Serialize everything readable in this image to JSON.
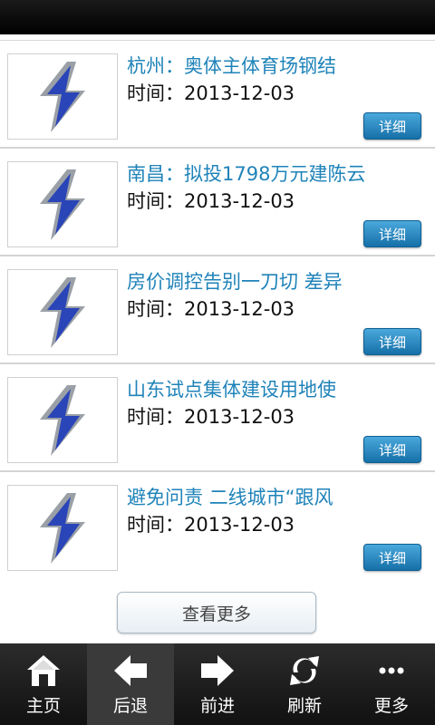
{
  "list": {
    "items": [
      {
        "title": "杭州：奥体主体育场钢结",
        "time": "时间：2013-12-03",
        "detail_label": "详细"
      },
      {
        "title": "南昌：拟投1798万元建陈云",
        "time": "时间：2013-12-03",
        "detail_label": "详细"
      },
      {
        "title": "房价调控告别一刀切 差异",
        "time": "时间：2013-12-03",
        "detail_label": "详细"
      },
      {
        "title": "山东试点集体建设用地使",
        "time": "时间：2013-12-03",
        "detail_label": "详细"
      },
      {
        "title": "避免问责 二线城市“跟风",
        "time": "时间：2013-12-03",
        "detail_label": "详细"
      }
    ]
  },
  "more_button": {
    "label": "查看更多"
  },
  "tabbar": {
    "tabs": [
      {
        "label": "主页",
        "icon": "home-icon"
      },
      {
        "label": "后退",
        "icon": "arrow-left-icon"
      },
      {
        "label": "前进",
        "icon": "arrow-right-icon"
      },
      {
        "label": "刷新",
        "icon": "refresh-icon"
      },
      {
        "label": "更多",
        "icon": "more-dots-icon"
      }
    ],
    "active_index": 1
  },
  "colors": {
    "title": "#1f83b9",
    "button": "#1670a8",
    "tabbar": "#1a1a1a"
  }
}
